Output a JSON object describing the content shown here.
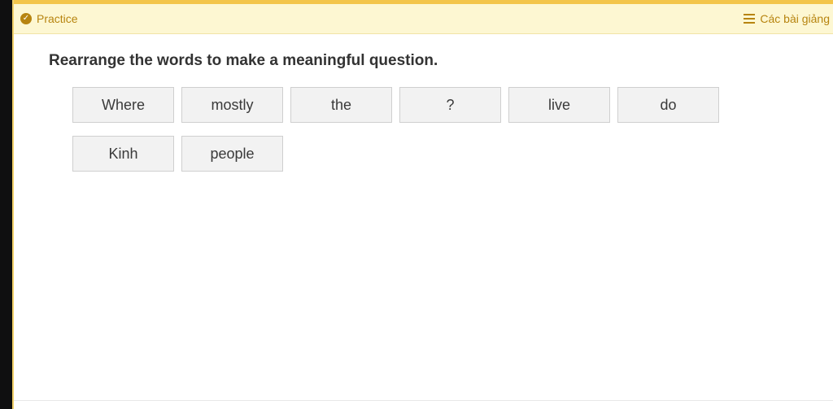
{
  "header": {
    "practice_label": "Practice",
    "lessons_label": "Các bài giảng"
  },
  "prompt": "Rearrange the words to make a meaningful question.",
  "words": [
    "Where",
    "mostly",
    "the",
    "?",
    "live",
    "do",
    "Kinh",
    "people"
  ],
  "colors": {
    "accent": "#b7840f",
    "header_bg": "#fdf7d2",
    "top_strip": "#f3c54a",
    "tile_bg": "#f2f2f2"
  }
}
